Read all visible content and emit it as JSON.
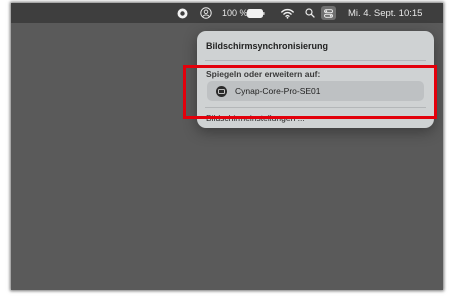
{
  "menubar": {
    "battery_percent": "100 %",
    "date_time": "Mi. 4. Sept.  10:15",
    "icons": [
      "record-icon",
      "user-icon",
      "battery-icon",
      "wifi-icon",
      "search-icon",
      "control-center-icon"
    ]
  },
  "dropdown": {
    "title": "Bildschirmsynchronisierung",
    "section_label": "Spiegeln oder erweitern auf:",
    "device_name": "Cynap-Core-Pro-SE01",
    "settings_label": "Bildschirmeinstellungen ..."
  },
  "colors": {
    "desktop": "#5a5a5a",
    "menubar": "#3e3e3e",
    "menu_bg": "#cfd2d3",
    "highlight_frame": "#e3000b"
  }
}
